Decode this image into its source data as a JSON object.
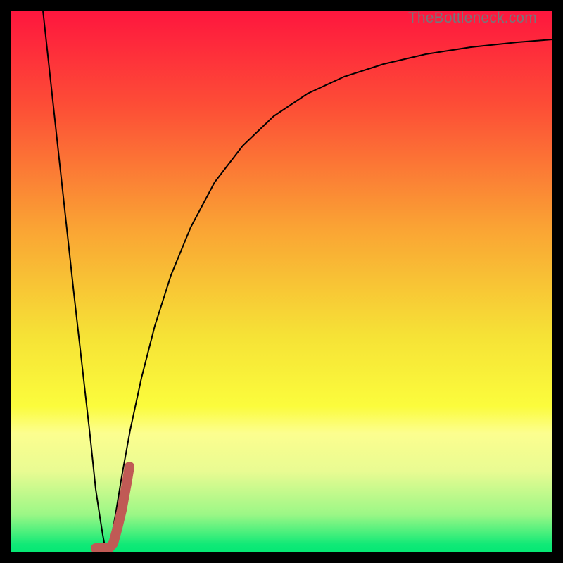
{
  "watermark": "TheBottleneck.com",
  "colors": {
    "frame": "#000000",
    "gradient_stops": [
      {
        "offset": 0.0,
        "color": "#fe163e"
      },
      {
        "offset": 0.18,
        "color": "#fd4f36"
      },
      {
        "offset": 0.4,
        "color": "#faa334"
      },
      {
        "offset": 0.6,
        "color": "#f6e236"
      },
      {
        "offset": 0.73,
        "color": "#fbfc3c"
      },
      {
        "offset": 0.78,
        "color": "#fcfe8f"
      },
      {
        "offset": 0.85,
        "color": "#e9fb92"
      },
      {
        "offset": 0.93,
        "color": "#9bf786"
      },
      {
        "offset": 0.965,
        "color": "#45ef7c"
      },
      {
        "offset": 0.985,
        "color": "#11e977"
      },
      {
        "offset": 1.0,
        "color": "#04e874"
      }
    ],
    "curve_main": "#000000",
    "marker": "#c05a55"
  },
  "chart_data": {
    "type": "line",
    "title": "",
    "xlabel": "",
    "ylabel": "",
    "xlim": [
      0,
      770
    ],
    "ylim_inverted": [
      0,
      770
    ],
    "series": [
      {
        "name": "bottleneck-curve",
        "stroke": "curve_main",
        "stroke_width": 2,
        "points": [
          [
            46,
            0
          ],
          [
            68,
            201
          ],
          [
            90,
            402
          ],
          [
            113,
            604
          ],
          [
            121,
            680
          ],
          [
            127,
            720
          ],
          [
            131,
            745
          ],
          [
            134,
            761
          ],
          [
            136,
            765
          ],
          [
            138,
            765
          ],
          [
            140,
            761
          ],
          [
            144,
            745
          ],
          [
            149,
            717
          ],
          [
            158,
            662
          ],
          [
            170,
            596
          ],
          [
            186,
            522
          ],
          [
            205,
            448
          ],
          [
            228,
            376
          ],
          [
            256,
            308
          ],
          [
            290,
            244
          ],
          [
            330,
            192
          ],
          [
            374,
            150
          ],
          [
            422,
            118
          ],
          [
            474,
            94
          ],
          [
            530,
            76
          ],
          [
            590,
            62
          ],
          [
            654,
            52
          ],
          [
            720,
            45
          ],
          [
            770,
            41
          ]
        ]
      },
      {
        "name": "marker-J",
        "stroke": "marker",
        "stroke_width": 14,
        "linecap": "round",
        "points": [
          [
            121,
            764
          ],
          [
            140,
            764
          ],
          [
            146,
            757
          ],
          [
            152,
            735
          ],
          [
            158,
            710
          ],
          [
            165,
            672
          ],
          [
            169,
            648
          ]
        ]
      }
    ]
  }
}
